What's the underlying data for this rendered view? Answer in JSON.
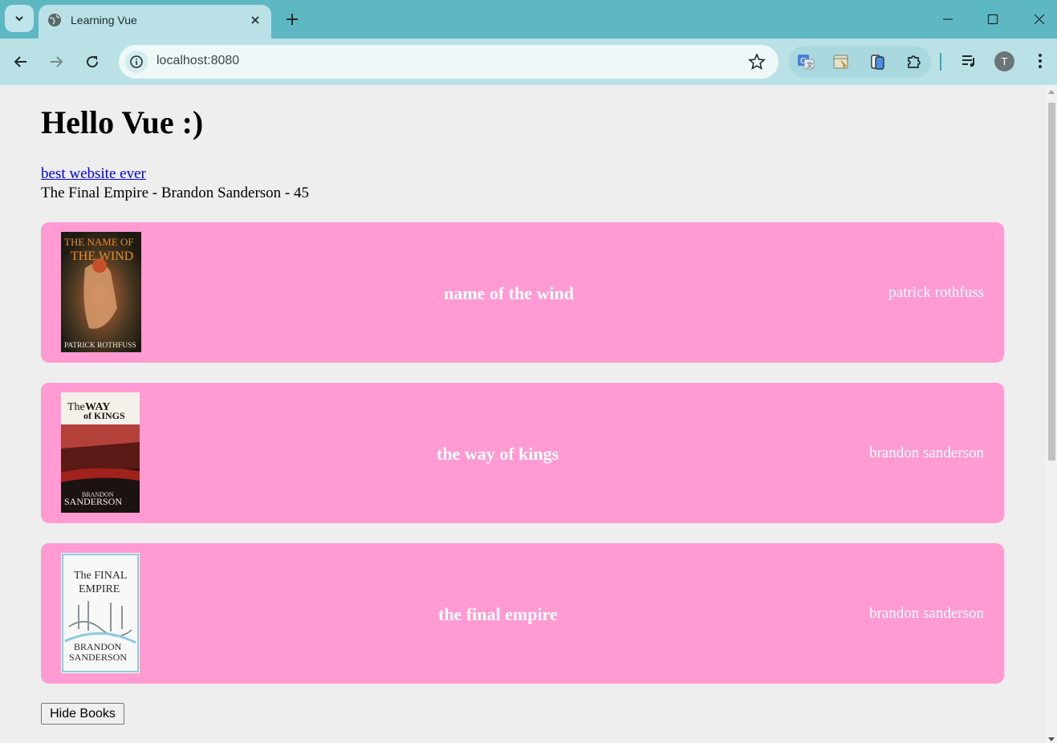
{
  "browser": {
    "tab_title": "Learning Vue",
    "url": "localhost:8080",
    "profile_initial": "T"
  },
  "page": {
    "heading": "Hello Vue :)",
    "link_text": "best website ever",
    "featured_line": "The Final Empire - Brandon Sanderson - 45",
    "books": [
      {
        "title": "name of the wind",
        "author": "patrick rothfuss",
        "cover_text": [
          "THE NAME OF",
          "THE WIND",
          "PATRICK ROTHFUSS"
        ]
      },
      {
        "title": "the way of kings",
        "author": "brandon sanderson",
        "cover_text": [
          "The",
          "WAY",
          "of KINGS",
          "BRANDON",
          "SANDERSON"
        ]
      },
      {
        "title": "the final empire",
        "author": "brandon sanderson",
        "cover_text": [
          "The FINAL",
          "EMPIRE",
          "BRANDON",
          "SANDERSON"
        ]
      }
    ],
    "hide_button_label": "Hide Books"
  },
  "colors": {
    "card_bg": "#ff9ad3",
    "tabstrip": "#5db8c4",
    "toolbar": "#b9e1e6",
    "link": "#0000ee"
  },
  "icons": [
    "tab-list-chevron-icon",
    "globe-icon",
    "close-icon",
    "plus-icon",
    "minimize-icon",
    "maximize-icon",
    "window-close-icon",
    "back-arrow-icon",
    "forward-arrow-icon",
    "reload-icon",
    "info-icon",
    "star-icon",
    "translate-icon",
    "extension-icon",
    "reading-icon",
    "puzzle-icon",
    "media-queue-icon",
    "menu-dots-icon"
  ]
}
